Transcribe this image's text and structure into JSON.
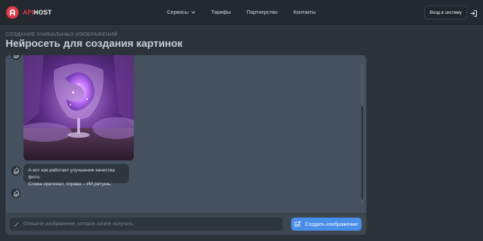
{
  "header": {
    "logo_api": "API",
    "logo_host": "HOST",
    "nav": [
      {
        "label": "Сервисы",
        "has_dropdown": true
      },
      {
        "label": "Тарифы"
      },
      {
        "label": "Партнерство"
      },
      {
        "label": "Контакты"
      }
    ],
    "login_label": "Вход в систему"
  },
  "page": {
    "subtitle": "СОЗДАНИЕ УНИКАЛЬНЫХ ИЗОБРАЖЕНИЙ",
    "title": "Нейросеть для создания картинок"
  },
  "chat": {
    "message_line1": "А вот как работает улучшение качества фото.",
    "message_line2": "Слева оригинал, справа – ИИ ретушь:"
  },
  "composer": {
    "placeholder": "Опишите изображение, которое хотите получить",
    "submit_label": "Создать изображение"
  },
  "colors": {
    "brand_red": "#e53946",
    "accent_blue": "#4a8eea",
    "panel_bg": "#45515e",
    "page_bg": "#2b323a"
  }
}
